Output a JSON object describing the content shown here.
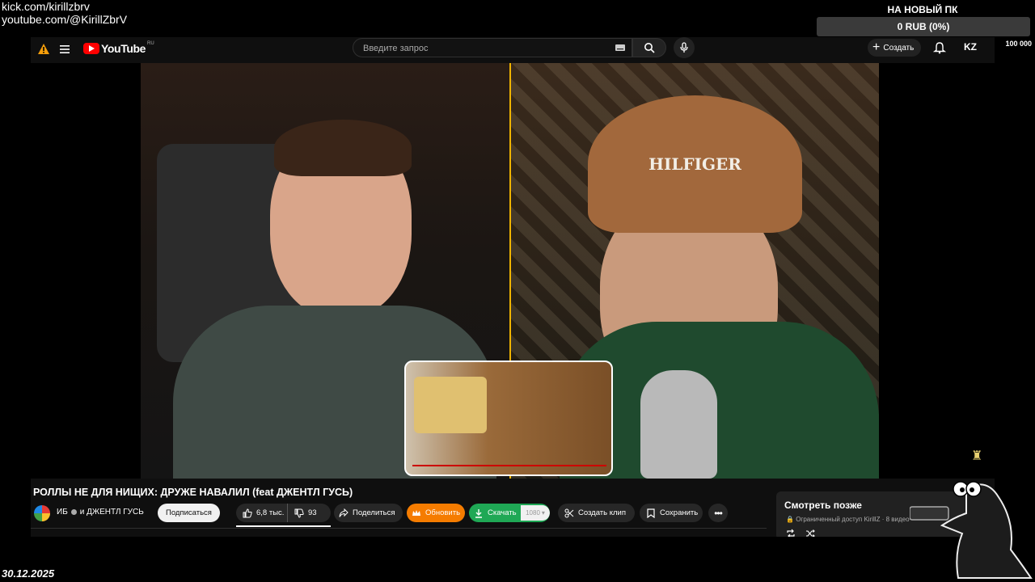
{
  "overlay": {
    "link_kick": "kick.com/kirillzbrv",
    "link_youtube": "youtube.com/@KirillZbrV",
    "date": "30.12.2025",
    "goal": {
      "title": "НА НОВЫЙ ПК",
      "progress_text": "0 RUB (0%)",
      "progress_fraction": 0,
      "min_label": "0",
      "max_label": "100 000"
    }
  },
  "masthead": {
    "logo_text": "YouTube",
    "country_code": "RU",
    "search_placeholder": "Введите запрос",
    "create_label": "Создать",
    "avatar_text": "KZ",
    "icons": [
      "warning-icon",
      "menu-icon",
      "keyboard-icon",
      "search-icon",
      "microphone-icon",
      "plus-icon",
      "bell-icon"
    ]
  },
  "video": {
    "title": "РОЛЛЫ НЕ ДЛЯ НИЩИХ: ДРУЖЕ НАВАЛИЛ (feat ДЖЕНТЛ ГУСЬ)",
    "channel_primary": "ИБ",
    "channel_secondary": "и ДЖЕНТЛ ГУСЬ",
    "subscribe_label": "Подписаться",
    "likes": "6,8 тыс.",
    "dislikes": "93",
    "share_label": "Поделиться",
    "update_label": "Обновить",
    "download_label": "Скачать",
    "quality": "1080",
    "clip_label": "Создать клип",
    "save_label": "Сохранить",
    "cam_left_text": "",
    "cam_right_cap_text": "HILFIGER"
  },
  "watch_later": {
    "title": "Смотреть позже",
    "access_label": "Ограниченный доступ",
    "owner": "KirillZ",
    "count": "8 видео"
  },
  "colors": {
    "accent_red": "#ff0000",
    "update_orange": "#f57c00",
    "download_green": "#1fa855",
    "divider_yellow": "#f0b400"
  }
}
